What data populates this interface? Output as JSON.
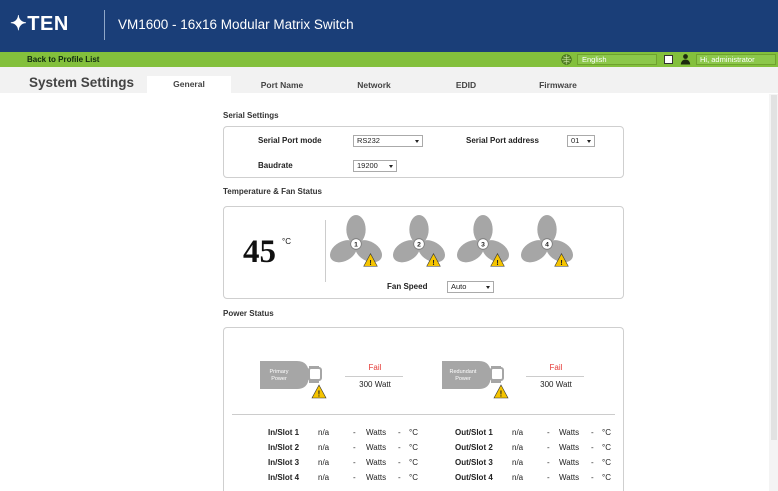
{
  "header": {
    "logo": "✦TEN",
    "title": "VM1600 - 16x16 Modular Matrix Switch",
    "back_link": "Back to Profile List",
    "language": "English",
    "user_greeting": "Hi, administrator"
  },
  "page_title": "System Settings",
  "tabs": [
    {
      "label": "General",
      "active": true
    },
    {
      "label": "Port Name"
    },
    {
      "label": "Network"
    },
    {
      "label": "EDID"
    },
    {
      "label": "Firmware"
    }
  ],
  "serial": {
    "section_title": "Serial Settings",
    "port_mode_label": "Serial Port mode",
    "port_mode_value": "RS232",
    "port_address_label": "Serial Port address",
    "port_address_value": "01",
    "baudrate_label": "Baudrate",
    "baudrate_value": "19200"
  },
  "temp_fan": {
    "section_title": "Temperature & Fan Status",
    "temperature": "45",
    "unit": "°C",
    "fans": [
      "1",
      "2",
      "3",
      "4"
    ],
    "fan_speed_label": "Fan Speed",
    "fan_speed_value": "Auto"
  },
  "power": {
    "section_title": "Power Status",
    "primary": {
      "label": "Primary Power",
      "status": "Fail",
      "watt": "300 Watt"
    },
    "redundant": {
      "label": "Redundant Power",
      "status": "Fail",
      "watt": "300 Watt"
    },
    "in_slots": [
      {
        "name": "In/Slot 1",
        "value": "n/a",
        "dash1": "-",
        "watts": "Watts",
        "dash2": "-",
        "unit": "°C"
      },
      {
        "name": "In/Slot 2",
        "value": "n/a",
        "dash1": "-",
        "watts": "Watts",
        "dash2": "-",
        "unit": "°C"
      },
      {
        "name": "In/Slot 3",
        "value": "n/a",
        "dash1": "-",
        "watts": "Watts",
        "dash2": "-",
        "unit": "°C"
      },
      {
        "name": "In/Slot 4",
        "value": "n/a",
        "dash1": "-",
        "watts": "Watts",
        "dash2": "-",
        "unit": "°C"
      }
    ],
    "out_slots": [
      {
        "name": "Out/Slot 1",
        "value": "n/a",
        "dash1": "-",
        "watts": "Watts",
        "dash2": "-",
        "unit": "°C"
      },
      {
        "name": "Out/Slot 2",
        "value": "n/a",
        "dash1": "-",
        "watts": "Watts",
        "dash2": "-",
        "unit": "°C"
      },
      {
        "name": "Out/Slot 3",
        "value": "n/a",
        "dash1": "-",
        "watts": "Watts",
        "dash2": "-",
        "unit": "°C"
      },
      {
        "name": "Out/Slot 4",
        "value": "n/a",
        "dash1": "-",
        "watts": "Watts",
        "dash2": "-",
        "unit": "°C"
      }
    ]
  },
  "colors": {
    "header_bg": "#1a3e78",
    "green_bar": "#83c03c",
    "fail_red": "#e53935",
    "warning_yellow": "#f5c400",
    "icon_gray": "#a6a6a6"
  }
}
